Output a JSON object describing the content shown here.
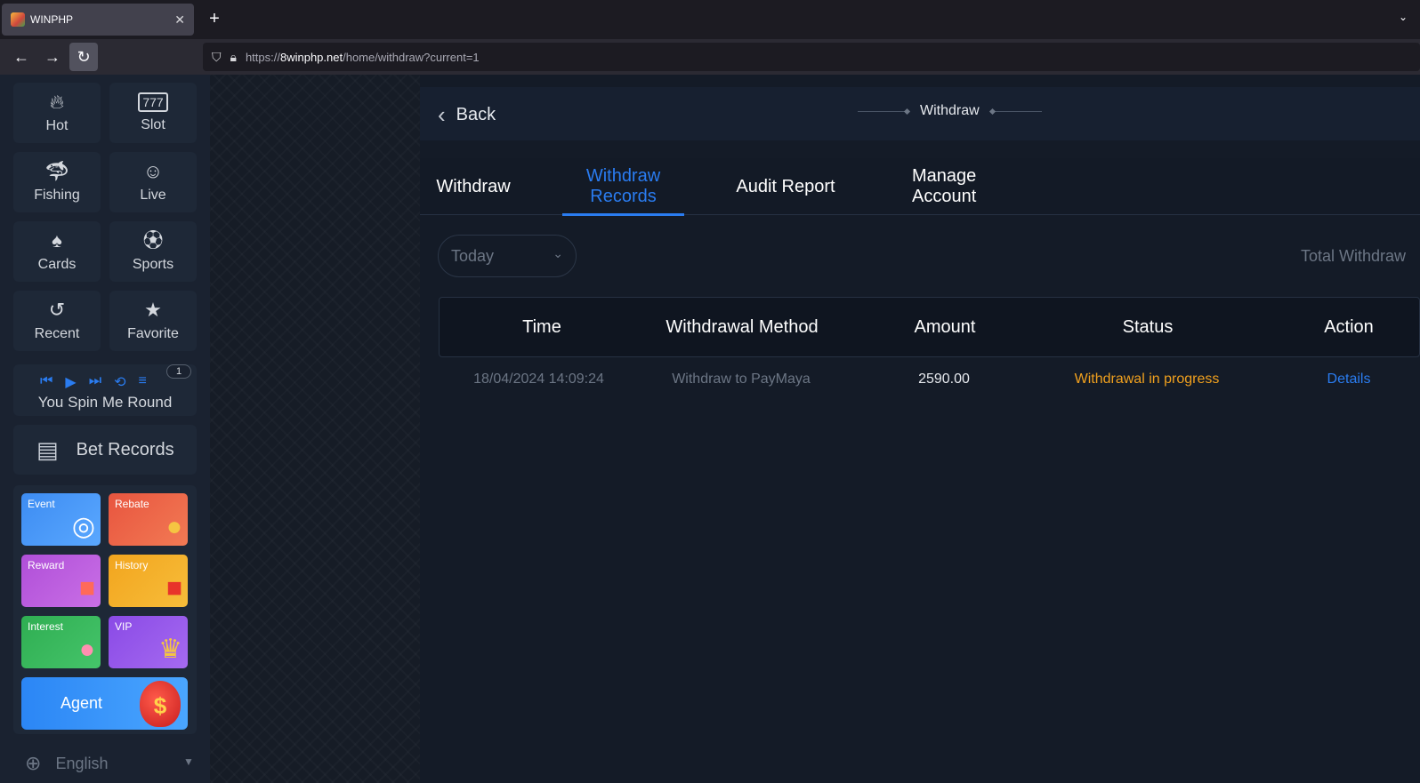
{
  "browser": {
    "tab_title": "WINPHP",
    "url_prefix": "https://",
    "url_domain": "8winphp.net",
    "url_path": "/home/withdraw?current=1"
  },
  "sidebar": {
    "categories": [
      {
        "label": "Hot",
        "icon": "flame-icon"
      },
      {
        "label": "Slot",
        "icon": "slot-777-icon"
      },
      {
        "label": "Fishing",
        "icon": "shark-icon"
      },
      {
        "label": "Live",
        "icon": "dealer-icon"
      },
      {
        "label": "Cards",
        "icon": "cards-icon"
      },
      {
        "label": "Sports",
        "icon": "soccer-ball-icon"
      },
      {
        "label": "Recent",
        "icon": "history-icon"
      },
      {
        "label": "Favorite",
        "icon": "star-icon"
      }
    ],
    "player": {
      "song": "You Spin Me Round",
      "badge": "1"
    },
    "bet_records": "Bet Records",
    "promos": [
      {
        "label": "Event",
        "color": "#3d8cf2"
      },
      {
        "label": "Rebate",
        "color": "#e8553f"
      },
      {
        "label": "Reward",
        "color": "#b04fd8"
      },
      {
        "label": "History",
        "color": "#f2a51e"
      },
      {
        "label": "Interest",
        "color": "#2fae52"
      },
      {
        "label": "VIP",
        "color": "#8a4ae6"
      }
    ],
    "agent": "Agent",
    "language": "English"
  },
  "header": {
    "back_label": "Back",
    "title": "Withdraw"
  },
  "tabs": [
    {
      "label": "Withdraw",
      "active": false
    },
    {
      "label": "Withdraw Records",
      "active": true
    },
    {
      "label": "Audit Report",
      "active": false
    },
    {
      "label": "Manage Account",
      "active": false
    }
  ],
  "filter": {
    "selected": "Today",
    "total_label": "Total Withdraw"
  },
  "table": {
    "columns": [
      "Time",
      "Withdrawal Method",
      "Amount",
      "Status",
      "Action"
    ],
    "rows": [
      {
        "time": "18/04/2024 14:09:24",
        "method": "Withdraw to PayMaya",
        "amount": "2590.00",
        "status": "Withdrawal in progress",
        "action": "Details"
      }
    ]
  },
  "colors": {
    "accent": "#2a7cf0",
    "status_in_progress": "#f0a01e"
  }
}
